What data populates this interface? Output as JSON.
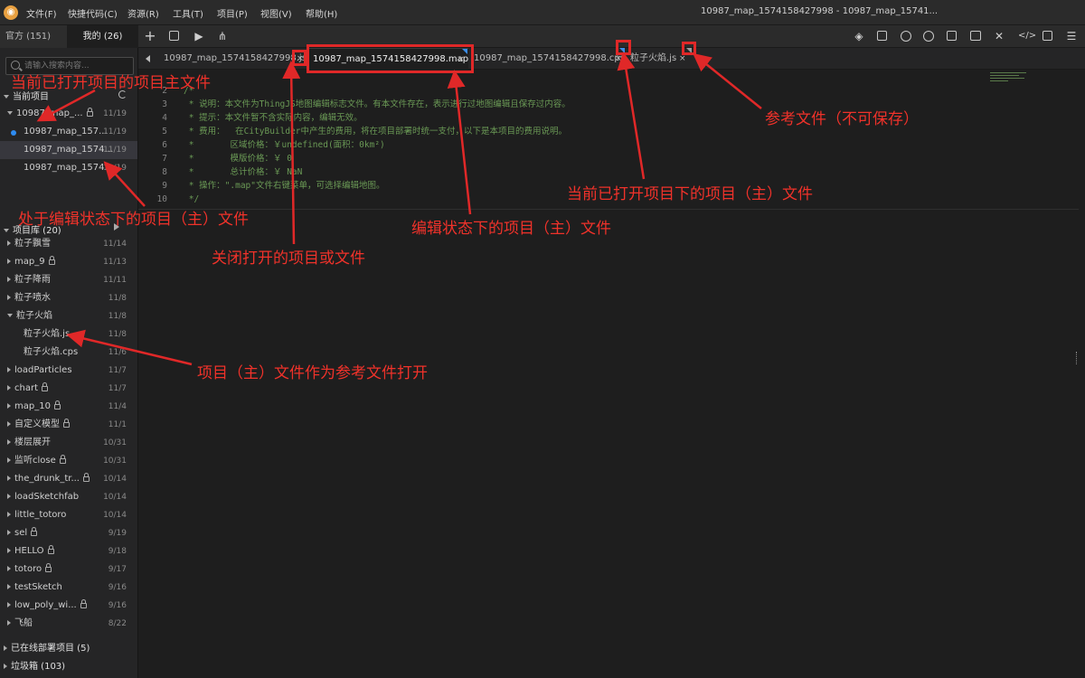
{
  "menubar": {
    "items": [
      "文件(F)",
      "快捷代码(C)",
      "资源(R)",
      "工具(T)",
      "项目(P)",
      "视图(V)",
      "帮助(H)"
    ],
    "window_title": "10987_map_1574158427998 - 10987_map_15741..."
  },
  "sidebar": {
    "tabs": [
      {
        "label": "官方 (151)"
      },
      {
        "label": "我的 (26)"
      }
    ],
    "search_placeholder": "请输入搜索内容...",
    "current_project_title": "当前项目",
    "current_project": {
      "folder": {
        "name": "10987_map_...",
        "date": "11/19",
        "locked": true
      },
      "files": [
        {
          "name": "10987_map_157...",
          "date": "11/19",
          "dot": true
        },
        {
          "name": "10987_map_1574...",
          "date": "11/19",
          "selected": true
        },
        {
          "name": "10987_map_1574...",
          "date": "11/19"
        }
      ]
    },
    "library_title": "项目库 (20)",
    "library": [
      {
        "name": "粒子飘雪",
        "date": "11/14",
        "locked": false
      },
      {
        "name": "map_9",
        "date": "11/13",
        "locked": true
      },
      {
        "name": "粒子降雨",
        "date": "11/11",
        "locked": false
      },
      {
        "name": "粒子喷水",
        "date": "11/8",
        "locked": false
      },
      {
        "name": "粒子火焰",
        "date": "11/8",
        "locked": false,
        "expanded": true
      },
      {
        "name": "粒子火焰.js",
        "date": "11/8",
        "child": true
      },
      {
        "name": "粒子火焰.cps",
        "date": "11/6",
        "child": true
      },
      {
        "name": "loadParticles",
        "date": "11/7",
        "locked": false
      },
      {
        "name": "chart",
        "date": "11/7",
        "locked": true
      },
      {
        "name": "map_10",
        "date": "11/4",
        "locked": true
      },
      {
        "name": "自定义模型",
        "date": "11/1",
        "locked": true
      },
      {
        "name": "楼层展开",
        "date": "10/31",
        "locked": false
      },
      {
        "name": "监听close",
        "date": "10/31",
        "locked": true
      },
      {
        "name": "the_drunk_tr...",
        "date": "10/14",
        "locked": true
      },
      {
        "name": "loadSketchfab",
        "date": "10/14",
        "locked": false
      },
      {
        "name": "little_totoro",
        "date": "10/14",
        "locked": false
      },
      {
        "name": "sel",
        "date": "9/19",
        "locked": true
      },
      {
        "name": "HELLO",
        "date": "9/18",
        "locked": true
      },
      {
        "name": "totoro",
        "date": "9/17",
        "locked": true
      },
      {
        "name": "testSketch",
        "date": "9/16",
        "locked": false
      },
      {
        "name": "low_poly_wi...",
        "date": "9/16",
        "locked": true
      },
      {
        "name": "飞船",
        "date": "8/22",
        "locked": false
      }
    ],
    "deployed_title": "已在线部署项目 (5)",
    "trash_title": "垃圾箱 (103)"
  },
  "tabs": [
    {
      "label": "10987_map_1574158427998.js",
      "close": "×",
      "active": false
    },
    {
      "label": "10987_map_1574158427998.map",
      "close": "×",
      "active": true
    },
    {
      "label": "10987_map_1574158427998.cps",
      "close": "×",
      "active": false
    },
    {
      "label": "粒子火焰.js",
      "close": "×",
      "active": false
    }
  ],
  "editor": {
    "lines": [
      {
        "n": "2",
        "text": "/*"
      },
      {
        "n": "3",
        "text": " * 说明：本文件为ThingJS地图编辑标志文件。有本文件存在，表示进行过地图编辑且保存过内容。"
      },
      {
        "n": "4",
        "text": " * 提示：本文件暂不含实际内容，编辑无效。"
      },
      {
        "n": "5",
        "text": " * 费用：  在CityBuilder中产生的费用，将在项目部署时统一支付，以下是本项目的费用说明。"
      },
      {
        "n": "6",
        "text": " *       区域价格：￥undefined(面积：0km²)"
      },
      {
        "n": "7",
        "text": " *       模版价格：￥ 0"
      },
      {
        "n": "8",
        "text": " *       总计价格：￥ NaN"
      },
      {
        "n": "9",
        "text": " * 操作：\".map\"文件右键菜单，可选择编辑地图。"
      },
      {
        "n": "10",
        "text": " */"
      }
    ]
  },
  "annotations": {
    "main_file": "当前已打开项目的项目主文件",
    "editing_file": "处于编辑状态下的项目（主）文件",
    "close_tab": "关闭打开的项目或文件",
    "editing_tab": "编辑状态下的项目（主）文件",
    "opened_main": "当前已打开项目下的项目（主）文件",
    "reference": "参考文件（不可保存）",
    "as_reference": "项目（主）文件作为参考文件打开"
  },
  "colors": {
    "accent_blue": "#2e8bf0",
    "annotation_red": "#e02828",
    "comment_green": "#6a9955"
  }
}
